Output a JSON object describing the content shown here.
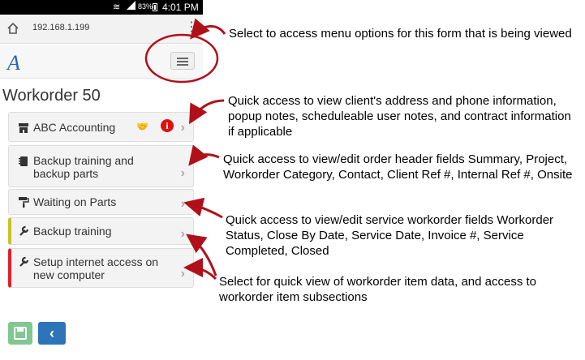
{
  "status_bar": {
    "battery": "83%",
    "time": "4:01 PM"
  },
  "browser": {
    "url": "192.168.1.199"
  },
  "app": {
    "logo": "A"
  },
  "page": {
    "title": "Workorder 50"
  },
  "cards": [
    {
      "label": "ABC Accounting",
      "icon": "building-icon"
    },
    {
      "label": "Backup training and backup parts",
      "icon": "notebook-icon"
    },
    {
      "label": "Waiting on Parts",
      "icon": "paint-roller-icon"
    },
    {
      "label": "Backup training",
      "icon": "wrench-icon"
    },
    {
      "label": "Setup internet access on new computer",
      "icon": "wrench-icon"
    }
  ],
  "annotations": [
    "Select to access menu options for this form that is being viewed",
    "Quick access to view client's address and phone information, popup notes, scheduleable user notes, and contract information if applicable",
    "Quick access to view/edit order header fields Summary, Project, Workorder Category, Contact, Client Ref #, Internal Ref #, Onsite",
    "Quick access to view/edit service workorder fields Workorder Status, Close By Date, Service Date, Invoice #, Service Completed, Closed",
    "Select for quick view of workorder item data, and access to workorder item subsections"
  ],
  "colors": {
    "annotation": "#b0101a",
    "accent": "#2d74b8",
    "save": "#80c890"
  }
}
